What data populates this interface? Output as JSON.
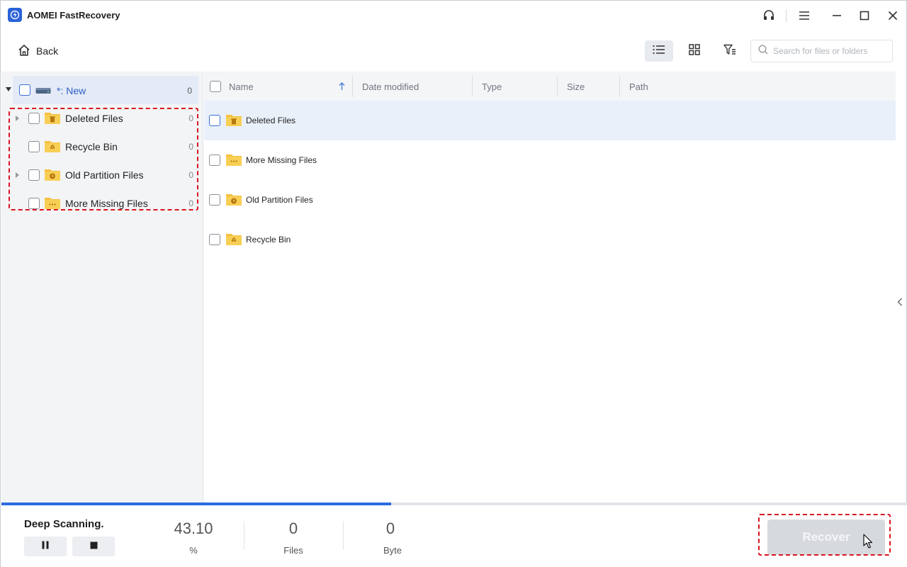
{
  "app": {
    "title": "AOMEI FastRecovery",
    "accent_color": "#2d6be0",
    "titlebar_icons": [
      "headset-icon",
      "menu-icon",
      "minimize-icon",
      "maximize-icon",
      "close-icon"
    ]
  },
  "toolbar": {
    "back_label": "Back",
    "view_modes": [
      "list-view-icon",
      "grid-view-icon",
      "filter-icon"
    ],
    "active_view": "list",
    "search_placeholder": "Search for files or folders"
  },
  "tree": {
    "root": {
      "label": "*: New",
      "count": "0"
    },
    "items": [
      {
        "label": "Deleted Files",
        "count": "0",
        "expandable": true,
        "icon": "trash-folder-icon"
      },
      {
        "label": "Recycle Bin",
        "count": "0",
        "expandable": false,
        "icon": "recycle-folder-icon"
      },
      {
        "label": "Old Partition Files",
        "count": "0",
        "expandable": true,
        "icon": "clock-folder-icon"
      },
      {
        "label": "More Missing Files",
        "count": "0",
        "expandable": false,
        "icon": "more-folder-icon"
      }
    ]
  },
  "list": {
    "columns": [
      "Name",
      "Date modified",
      "Type",
      "Size",
      "Path"
    ],
    "sort_column": "Name",
    "sort_direction": "ascending",
    "rows": [
      {
        "name": "Deleted Files",
        "icon": "trash-folder-icon",
        "selected": true
      },
      {
        "name": "More Missing Files",
        "icon": "more-folder-icon",
        "selected": false
      },
      {
        "name": "Old Partition Files",
        "icon": "clock-folder-icon",
        "selected": false
      },
      {
        "name": "Recycle Bin",
        "icon": "recycle-folder-icon",
        "selected": false
      }
    ]
  },
  "status": {
    "scan_label": "Deep Scanning.",
    "progress_fraction": 0.43,
    "percent_value": "43.10",
    "percent_label": "%",
    "files_value": "0",
    "files_label": "Files",
    "bytes_value": "0",
    "bytes_label": "Byte",
    "recover_label": "Recover"
  }
}
